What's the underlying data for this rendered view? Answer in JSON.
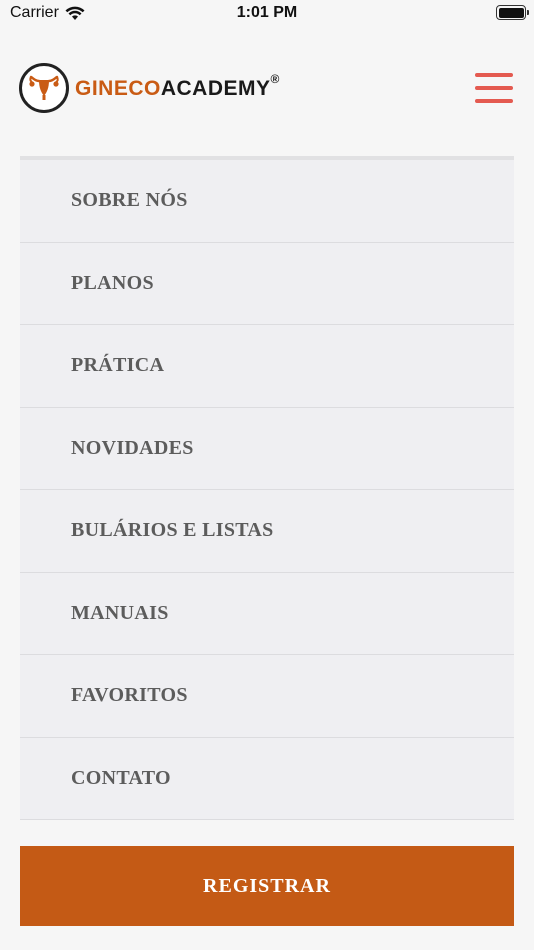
{
  "status_bar": {
    "carrier": "Carrier",
    "time": "1:01 PM"
  },
  "header": {
    "logo_part1": "GINECO",
    "logo_part2": "ACADEMY",
    "logo_mark": "®",
    "accent_color": "#c95b14",
    "menu_icon": "hamburger-icon"
  },
  "menu": {
    "items": [
      {
        "label": "SOBRE NÓS"
      },
      {
        "label": "PLANOS"
      },
      {
        "label": "PRÁTICA"
      },
      {
        "label": "NOVIDADES"
      },
      {
        "label": "BULÁRIOS E LISTAS"
      },
      {
        "label": "MANUAIS"
      },
      {
        "label": "FAVORITOS"
      },
      {
        "label": "CONTATO"
      }
    ]
  },
  "register": {
    "label": "REGISTRAR",
    "color": "#c45a15"
  }
}
